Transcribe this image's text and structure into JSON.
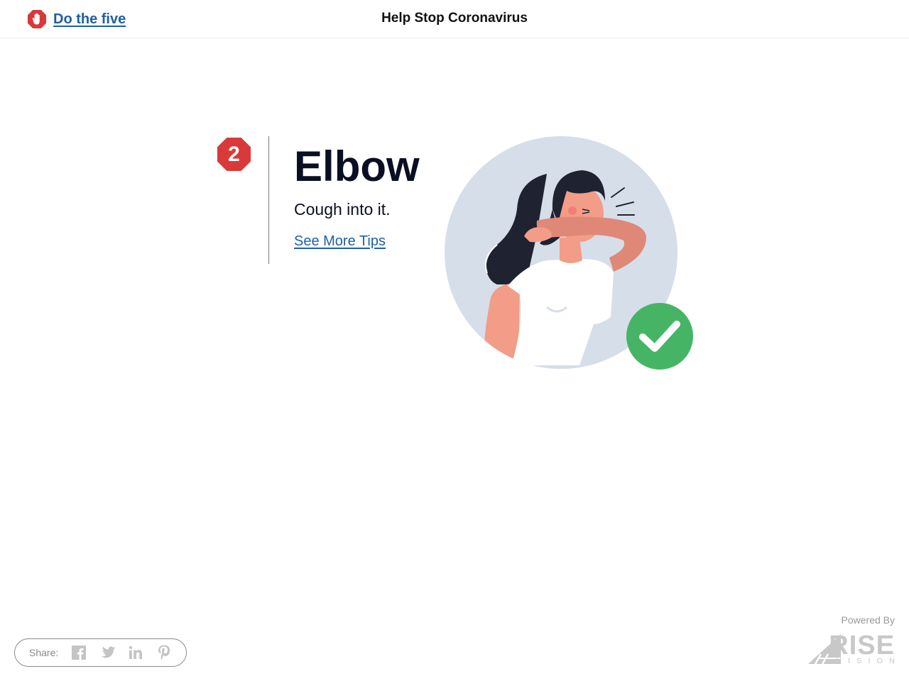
{
  "header": {
    "brand_link": "Do the five",
    "title": "Help Stop Coronavirus"
  },
  "step": {
    "number": "2",
    "title": "Elbow",
    "description": "Cough into it.",
    "link": "See More Tips"
  },
  "footer": {
    "share_label": "Share:",
    "share_icons": [
      "facebook-icon",
      "twitter-icon",
      "linkedin-icon",
      "pinterest-icon"
    ],
    "powered_by": "Powered By",
    "logo_rise": "RISE",
    "logo_vision": "VISION"
  },
  "colors": {
    "link": "#1d5fa8",
    "badge_red": "#d83a3a",
    "check_green": "#45b565",
    "circle_bg": "#d5dee9",
    "skin": "#f39c87",
    "hair": "#1f2230"
  }
}
